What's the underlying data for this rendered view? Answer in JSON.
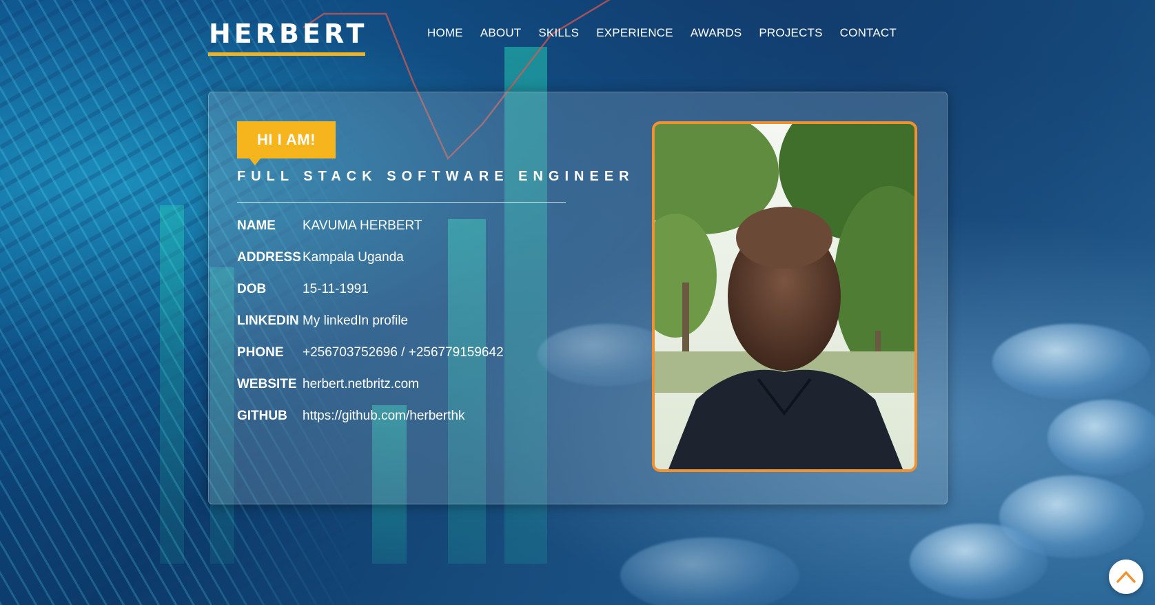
{
  "brand": {
    "name": "HERBERT",
    "accent": "#f4b31c"
  },
  "nav": {
    "items": [
      {
        "label": "HOME"
      },
      {
        "label": "ABOUT"
      },
      {
        "label": "SKILLS"
      },
      {
        "label": "EXPERIENCE"
      },
      {
        "label": "AWARDS"
      },
      {
        "label": "PROJECTS"
      },
      {
        "label": "CONTACT"
      }
    ]
  },
  "hero": {
    "greeting": "HI I AM!",
    "role": "FULL STACK SOFTWARE ENGINEER",
    "badge_color": "#f6b51c",
    "photo_border_color": "#f2922e",
    "details": [
      {
        "key": "NAME",
        "value": "KAVUMA HERBERT"
      },
      {
        "key": "ADDRESS",
        "value": "Kampala Uganda"
      },
      {
        "key": "DOB",
        "value": "15-11-1991"
      },
      {
        "key": "LINKEDIN",
        "value": "My linkedIn profile"
      },
      {
        "key": "PHONE",
        "value": "+256703752696 / +256779159642"
      },
      {
        "key": "WEBSITE",
        "value": "herbert.netbritz.com"
      },
      {
        "key": "GITHUB",
        "value": "https://github.com/herberthk"
      }
    ]
  },
  "icons": {
    "scroll_top": "chevron-up-icon",
    "scroll_top_color": "#f2922e"
  }
}
